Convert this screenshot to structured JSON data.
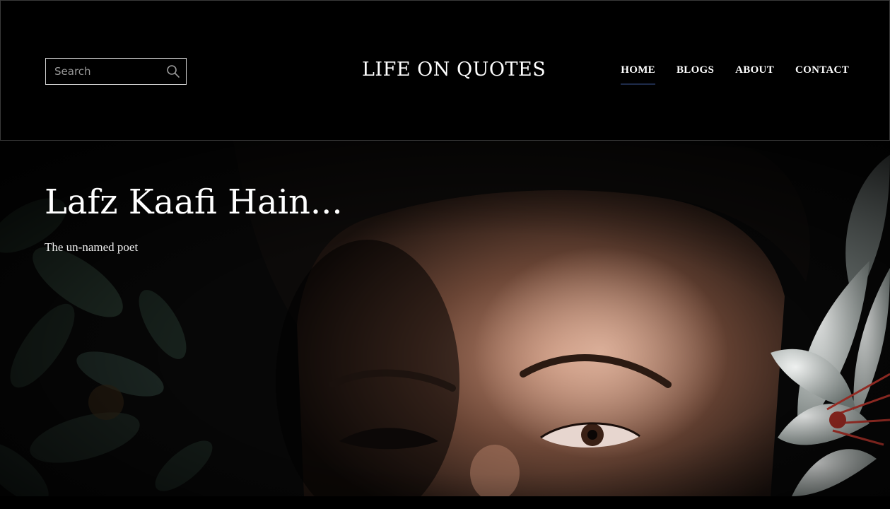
{
  "header": {
    "search_placeholder": "Search",
    "search_icon": "search-icon",
    "logo": "LIFE ON QUOTES",
    "nav": [
      {
        "label": "HOME",
        "active": true
      },
      {
        "label": "BLOGS",
        "active": false
      },
      {
        "label": "ABOUT",
        "active": false
      },
      {
        "label": "CONTACT",
        "active": false
      }
    ]
  },
  "hero": {
    "title": "Lafz Kaafi Hain...",
    "subtitle": "The un-named poet"
  },
  "colors": {
    "background": "#000000",
    "text": "#ffffff",
    "nav_active_underline": "#1e2b4a"
  }
}
